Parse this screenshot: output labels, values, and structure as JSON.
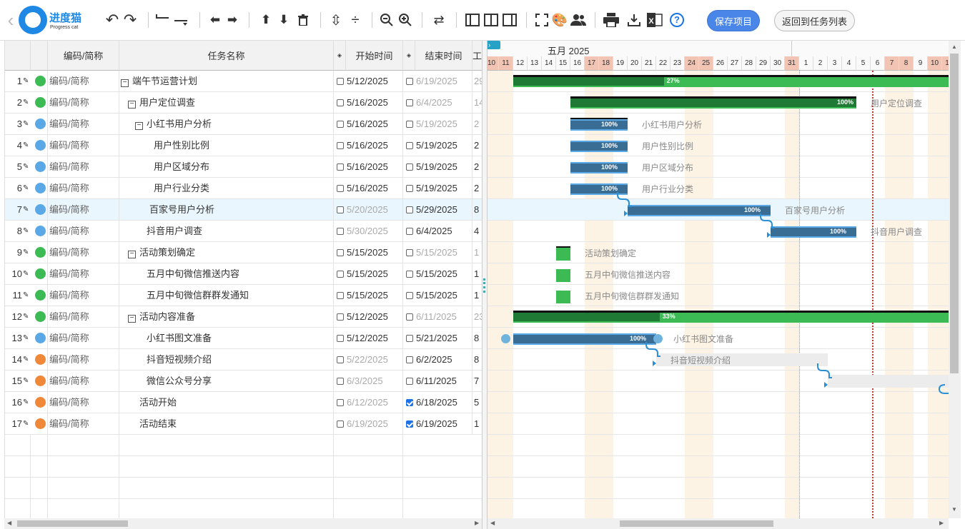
{
  "app": {
    "logo_cn": "进度猫",
    "logo_en": "Progress cat"
  },
  "toolbar": {
    "save_label": "保存项目",
    "back_label": "返回到任务列表",
    "help_label": "?"
  },
  "grid": {
    "columns": [
      "编码/简称",
      "任务名称",
      "开始时间",
      "结束时间",
      "工"
    ],
    "rows": [
      {
        "num": "1",
        "code": "编码/简称",
        "name": "端午节运营计划",
        "indent": 0,
        "fold": "−",
        "start": "5/12/2025",
        "end": "6/19/2025",
        "dur": "29",
        "dot": "#3cba54",
        "start_gray": false,
        "end_gray": true,
        "dur_gray": true,
        "end_checked": false
      },
      {
        "num": "2",
        "code": "编码/简称",
        "name": "用户定位调查",
        "indent": 1,
        "fold": "−",
        "start": "5/16/2025",
        "end": "6/4/2025",
        "dur": "14",
        "dot": "#3cba54",
        "start_gray": false,
        "end_gray": true,
        "dur_gray": true,
        "end_checked": false
      },
      {
        "num": "3",
        "code": "编码/简称",
        "name": "小红书用户分析",
        "indent": 2,
        "fold": "−",
        "start": "5/16/2025",
        "end": "5/19/2025",
        "dur": "2",
        "dot": "#5aa9e6",
        "start_gray": false,
        "end_gray": true,
        "dur_gray": true,
        "end_checked": false
      },
      {
        "num": "4",
        "code": "编码/简称",
        "name": "用户性别比例",
        "indent": 3,
        "fold": "",
        "start": "5/16/2025",
        "end": "5/19/2025",
        "dur": "2",
        "dot": "#5aa9e6",
        "start_gray": false,
        "end_gray": false,
        "dur_gray": false,
        "end_checked": false
      },
      {
        "num": "5",
        "code": "编码/简称",
        "name": "用户区域分布",
        "indent": 3,
        "fold": "",
        "start": "5/16/2025",
        "end": "5/19/2025",
        "dur": "2",
        "dot": "#5aa9e6",
        "start_gray": false,
        "end_gray": false,
        "dur_gray": false,
        "end_checked": false
      },
      {
        "num": "6",
        "code": "编码/简称",
        "name": "用户行业分类",
        "indent": 3,
        "fold": "",
        "start": "5/16/2025",
        "end": "5/19/2025",
        "dur": "2",
        "dot": "#5aa9e6",
        "start_gray": false,
        "end_gray": false,
        "dur_gray": false,
        "end_checked": false
      },
      {
        "num": "7",
        "code": "编码/简称",
        "name": "百家号用户分析",
        "indent": 2.4,
        "fold": "",
        "start": "5/20/2025",
        "end": "5/29/2025",
        "dur": "8",
        "dot": "#5aa9e6",
        "start_gray": true,
        "end_gray": false,
        "dur_gray": false,
        "end_checked": false
      },
      {
        "num": "8",
        "code": "编码/简称",
        "name": "抖音用户调查",
        "indent": 2,
        "fold": "",
        "start": "5/30/2025",
        "end": "6/4/2025",
        "dur": "4",
        "dot": "#5aa9e6",
        "start_gray": true,
        "end_gray": false,
        "dur_gray": false,
        "end_checked": false
      },
      {
        "num": "9",
        "code": "编码/简称",
        "name": "活动策划确定",
        "indent": 1,
        "fold": "−",
        "start": "5/15/2025",
        "end": "5/15/2025",
        "dur": "1",
        "dot": "#3cba54",
        "start_gray": false,
        "end_gray": true,
        "dur_gray": true,
        "end_checked": false
      },
      {
        "num": "10",
        "code": "编码/简称",
        "name": "五月中旬微信推送内容",
        "indent": 2,
        "fold": "",
        "start": "5/15/2025",
        "end": "5/15/2025",
        "dur": "1",
        "dot": "#3cba54",
        "start_gray": false,
        "end_gray": false,
        "dur_gray": false,
        "end_checked": false
      },
      {
        "num": "11",
        "code": "编码/简称",
        "name": "五月中旬微信群群发通知",
        "indent": 2,
        "fold": "",
        "start": "5/15/2025",
        "end": "5/15/2025",
        "dur": "1",
        "dot": "#3cba54",
        "start_gray": false,
        "end_gray": false,
        "dur_gray": false,
        "end_checked": false
      },
      {
        "num": "12",
        "code": "编码/简称",
        "name": "活动内容准备",
        "indent": 1,
        "fold": "−",
        "start": "5/12/2025",
        "end": "6/11/2025",
        "dur": "23",
        "dot": "#3cba54",
        "start_gray": false,
        "end_gray": true,
        "dur_gray": true,
        "end_checked": false
      },
      {
        "num": "13",
        "code": "编码/简称",
        "name": "小红书图文准备",
        "indent": 2,
        "fold": "",
        "start": "5/12/2025",
        "end": "5/21/2025",
        "dur": "8",
        "dot": "#5aa9e6",
        "start_gray": false,
        "end_gray": false,
        "dur_gray": false,
        "end_checked": false
      },
      {
        "num": "14",
        "code": "编码/简称",
        "name": "抖音短视频介绍",
        "indent": 2,
        "fold": "",
        "start": "5/22/2025",
        "end": "6/2/2025",
        "dur": "8",
        "dot": "#f0883a",
        "start_gray": true,
        "end_gray": false,
        "dur_gray": false,
        "end_checked": false
      },
      {
        "num": "15",
        "code": "编码/简称",
        "name": "微信公众号分享",
        "indent": 2,
        "fold": "",
        "start": "6/3/2025",
        "end": "6/11/2025",
        "dur": "7",
        "dot": "#f0883a",
        "start_gray": true,
        "end_gray": false,
        "dur_gray": false,
        "end_checked": false
      },
      {
        "num": "16",
        "code": "编码/简称",
        "name": "活动开始",
        "indent": 1,
        "fold": "",
        "start": "6/12/2025",
        "end": "6/18/2025",
        "dur": "5",
        "dot": "#f0883a",
        "start_gray": true,
        "end_gray": false,
        "dur_gray": false,
        "end_checked": true
      },
      {
        "num": "17",
        "code": "编码/简称",
        "name": "活动结束",
        "indent": 1,
        "fold": "",
        "start": "6/19/2025",
        "end": "6/19/2025",
        "dur": "1",
        "dot": "#f0883a",
        "start_gray": true,
        "end_gray": false,
        "dur_gray": false,
        "end_checked": true
      }
    ]
  },
  "gantt": {
    "month_label": "五月 2025",
    "days": [
      "10",
      "11",
      "12",
      "13",
      "14",
      "15",
      "16",
      "17",
      "18",
      "19",
      "20",
      "21",
      "22",
      "23",
      "24",
      "25",
      "26",
      "27",
      "28",
      "29",
      "30",
      "31",
      "1",
      "2",
      "3",
      "4",
      "5",
      "6",
      "7",
      "8",
      "9",
      "10",
      "11"
    ],
    "weekend_days": [
      "10",
      "11",
      "17",
      "18",
      "24",
      "25",
      "31",
      "7",
      "8"
    ],
    "colors": {
      "green": "#3cba54",
      "dark_green": "#1e7a34",
      "blue": "#5aa9e6",
      "dark_blue": "#3a6d94",
      "placeholder": "#ececec",
      "today_line": "#c0392b"
    },
    "bars": [
      {
        "row": 0,
        "type": "summary",
        "start": "5/12",
        "end": "6/19",
        "pct": "27%",
        "progress": 0.27,
        "label": ""
      },
      {
        "row": 1,
        "type": "summary",
        "start": "5/16",
        "end": "6/4",
        "pct": "100%",
        "progress": 1.0,
        "label": "用户定位调查"
      },
      {
        "row": 2,
        "type": "task",
        "start": "5/16",
        "end": "5/19",
        "pct": "100%",
        "progress": 1.0,
        "label": "小红书用户分析",
        "topline": true
      },
      {
        "row": 3,
        "type": "task",
        "start": "5/16",
        "end": "5/19",
        "pct": "100%",
        "progress": 1.0,
        "label": "用户性别比例"
      },
      {
        "row": 4,
        "type": "task",
        "start": "5/16",
        "end": "5/19",
        "pct": "100%",
        "progress": 1.0,
        "label": "用户区域分布"
      },
      {
        "row": 5,
        "type": "task",
        "start": "5/16",
        "end": "5/19",
        "pct": "100%",
        "progress": 1.0,
        "label": "用户行业分类"
      },
      {
        "row": 6,
        "type": "task",
        "start": "5/20",
        "end": "5/29",
        "pct": "100%",
        "progress": 1.0,
        "label": "百家号用户分析"
      },
      {
        "row": 7,
        "type": "task",
        "start": "5/30",
        "end": "6/4",
        "pct": "100%",
        "progress": 1.0,
        "label": "抖音用户调查"
      },
      {
        "row": 8,
        "type": "milestone",
        "start": "5/15",
        "end": "5/15",
        "pct": "",
        "progress": 0,
        "label": "活动策划确定",
        "topline": true
      },
      {
        "row": 9,
        "type": "milestone",
        "start": "5/15",
        "end": "5/15",
        "pct": "",
        "progress": 0,
        "label": "五月中旬微信推送内容"
      },
      {
        "row": 10,
        "type": "milestone",
        "start": "5/15",
        "end": "5/15",
        "pct": "",
        "progress": 0,
        "label": "五月中旬微信群群发通知"
      },
      {
        "row": 11,
        "type": "summary",
        "start": "5/12",
        "end": "6/11",
        "pct": "33%",
        "progress": 0.33,
        "label": ""
      },
      {
        "row": 12,
        "type": "task",
        "start": "5/12",
        "end": "5/21",
        "pct": "100%",
        "progress": 1.0,
        "label": "小红书图文准备",
        "handles": true
      },
      {
        "row": 13,
        "type": "empty",
        "start": "5/22",
        "end": "6/2",
        "pct": "",
        "progress": 0,
        "label": "抖音短视频介绍"
      },
      {
        "row": 14,
        "type": "empty",
        "start": "6/3",
        "end": "6/11",
        "pct": "",
        "progress": 0,
        "label": ""
      }
    ]
  }
}
